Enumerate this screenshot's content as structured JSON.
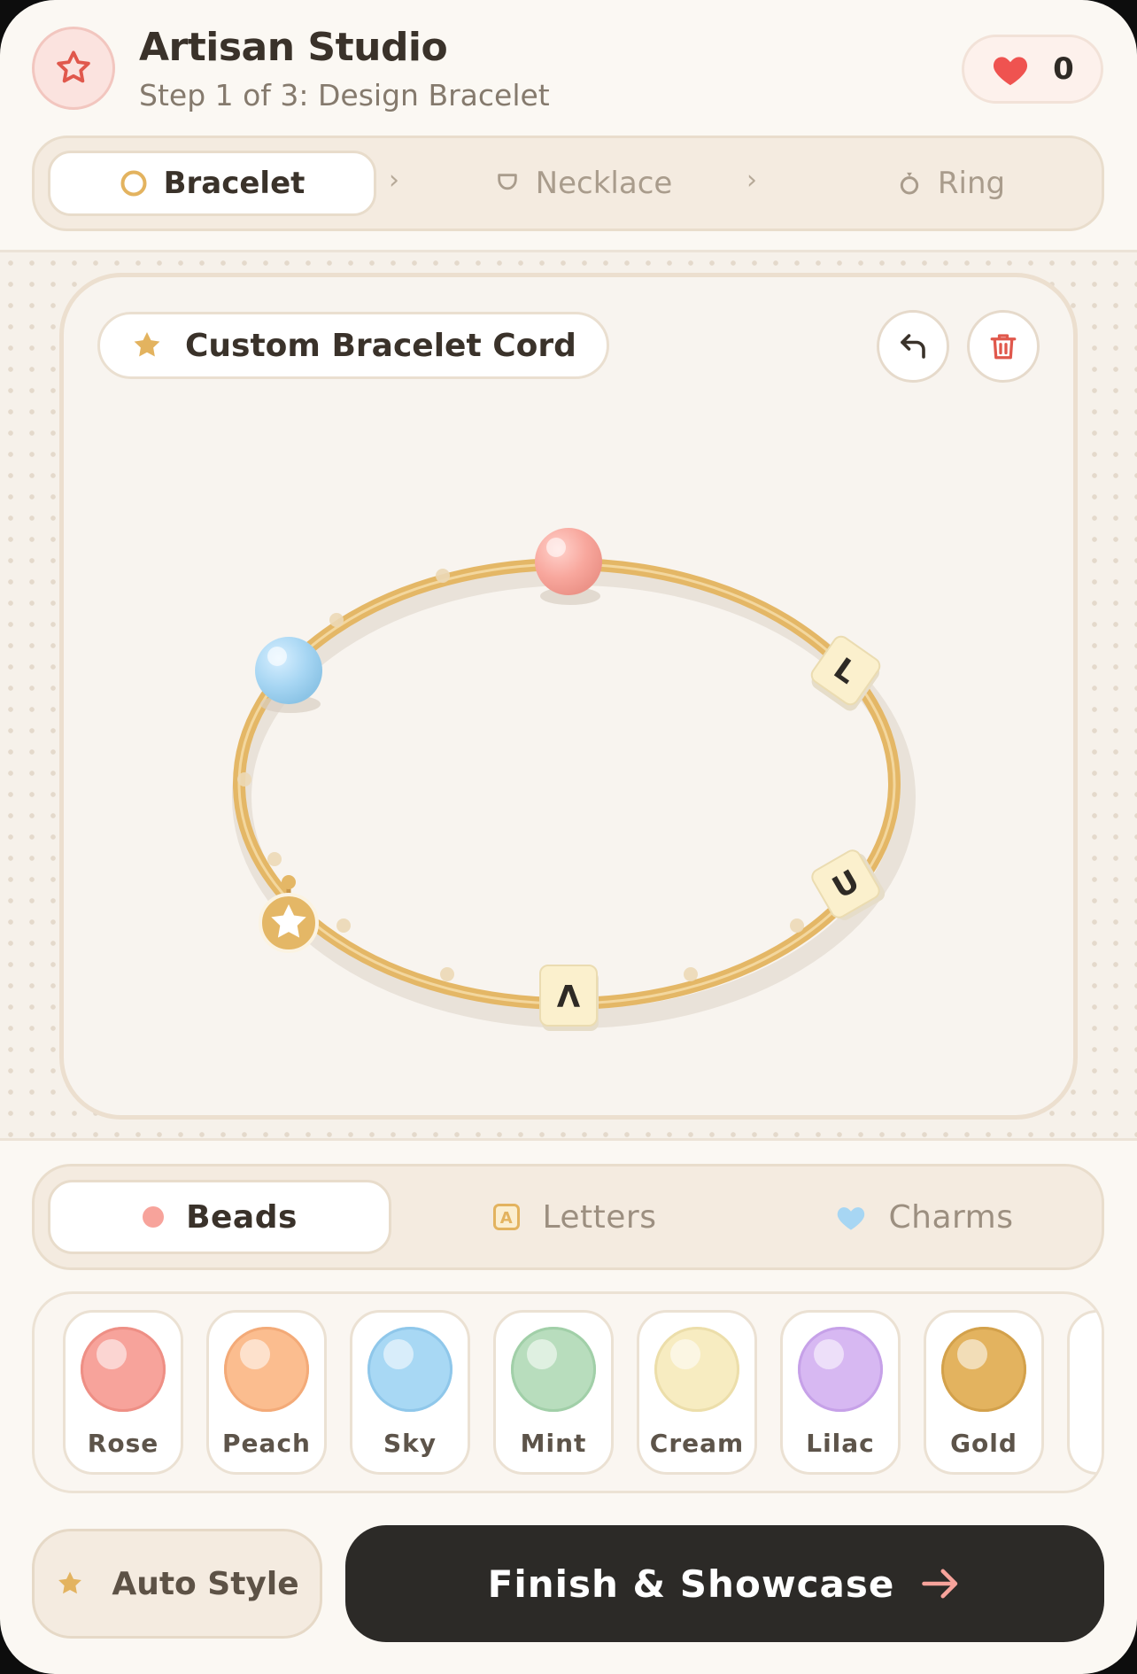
{
  "header": {
    "title": "Artisan Studio",
    "subtitle": "Step 1 of 3: Design Bracelet",
    "likes_count": "0",
    "logo_icon": "star-outline-icon",
    "likes_icon": "heart-icon"
  },
  "steps": [
    {
      "label": "Bracelet",
      "icon": "ring-outline-icon",
      "active": true
    },
    {
      "label": "Necklace",
      "icon": "necklace-icon",
      "active": false
    },
    {
      "label": "Ring",
      "icon": "ring-icon",
      "active": false
    }
  ],
  "canvas": {
    "cord_label": "Custom Bracelet Cord",
    "cord_icon": "star-icon",
    "undo_icon": "undo-icon",
    "delete_icon": "trash-icon",
    "beads": [
      {
        "kind": "bead",
        "color": "#f7aaa0"
      },
      {
        "kind": "bead",
        "color": "#a7d6f3"
      },
      {
        "kind": "letter",
        "text": "L"
      },
      {
        "kind": "letter",
        "text": "U"
      },
      {
        "kind": "letter",
        "text": "V"
      },
      {
        "kind": "charm",
        "icon": "star-charm-icon"
      }
    ]
  },
  "material_tabs": [
    {
      "label": "Beads",
      "icon": "dot-icon",
      "active": true
    },
    {
      "label": "Letters",
      "icon": "letter-a-icon",
      "active": false
    },
    {
      "label": "Charms",
      "icon": "heart-icon",
      "active": false
    }
  ],
  "swatches": [
    {
      "name": "Rose",
      "color": "#f7a39b"
    },
    {
      "name": "Peach",
      "color": "#fbbd8f"
    },
    {
      "name": "Sky",
      "color": "#a8d8f4"
    },
    {
      "name": "Mint",
      "color": "#b8ddbd"
    },
    {
      "name": "Cream",
      "color": "#f7ecc1"
    },
    {
      "name": "Lilac",
      "color": "#d7b8f2"
    },
    {
      "name": "Gold",
      "color": "#e3b35f"
    }
  ],
  "actions": {
    "auto_style": "Auto Style",
    "finish": "Finish & Showcase"
  },
  "colors": {
    "accent_gold": "#e3b35f",
    "dark_button": "#2c2a27",
    "heart": "#ef5350",
    "rose": "#f7a39b"
  }
}
